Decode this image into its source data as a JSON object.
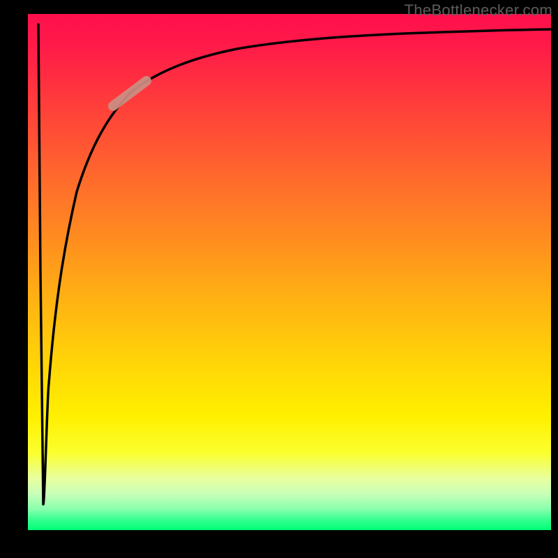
{
  "watermark": "TheBottlenecker.com",
  "colors": {
    "background": "#000000",
    "gradient_top": "#ff0f4c",
    "gradient_bottom": "#00ff78",
    "curve": "#000000",
    "marker": "#cc8f84"
  },
  "chart_data": {
    "type": "line",
    "title": "",
    "xlabel": "",
    "ylabel": "",
    "xlim": [
      0,
      100
    ],
    "ylim": [
      0,
      100
    ],
    "annotations": [
      "TheBottlenecker.com"
    ],
    "marker": {
      "x_range": [
        16,
        23
      ],
      "y_range": [
        82,
        87
      ]
    },
    "series": [
      {
        "name": "bottleneck-curve",
        "x": [
          2,
          2.5,
          3,
          4,
          5,
          6,
          8,
          10,
          12,
          15,
          18,
          22,
          28,
          35,
          45,
          55,
          65,
          75,
          85,
          95,
          100
        ],
        "y": [
          98,
          50,
          5,
          28,
          45,
          55,
          65,
          72,
          77,
          82,
          85,
          88,
          90.5,
          92.5,
          94,
          95,
          95.8,
          96.3,
          96.7,
          97,
          97.2
        ]
      }
    ]
  }
}
